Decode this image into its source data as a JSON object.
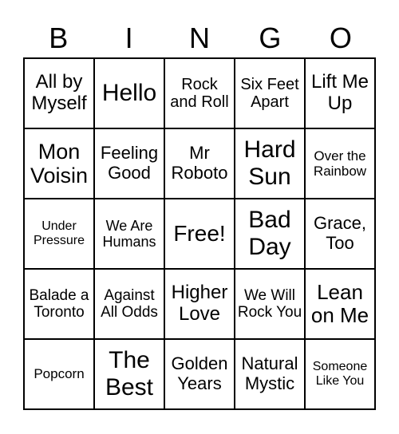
{
  "header": [
    "B",
    "I",
    "N",
    "G",
    "O"
  ],
  "cells": [
    [
      "All by Myself",
      "Hello",
      "Rock and Roll",
      "Six Feet Apart",
      "Lift Me Up"
    ],
    [
      "Mon Voisin",
      "Feeling Good",
      "Mr Roboto",
      "Hard Sun",
      "Over the Rainbow"
    ],
    [
      "Under Pressure",
      "We Are Humans",
      "Free!",
      "Bad Day",
      "Grace, Too"
    ],
    [
      "Balade a Toronto",
      "Against All Odds",
      "Higher Love",
      "We Will Rock You",
      "Lean on Me"
    ],
    [
      "Popcorn",
      "The Best",
      "Golden Years",
      "Natural Mystic",
      "Someone Like You"
    ]
  ]
}
